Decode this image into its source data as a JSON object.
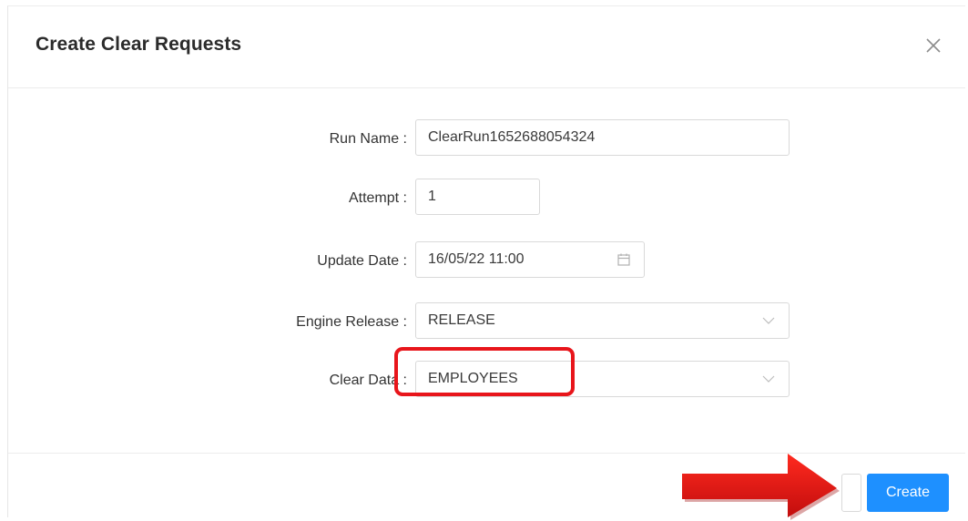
{
  "dialog": {
    "title": "Create Clear Requests"
  },
  "form": {
    "run_name": {
      "label": "Run Name :",
      "value": "ClearRun1652688054324"
    },
    "attempt": {
      "label": "Attempt :",
      "value": "1"
    },
    "update_date": {
      "label": "Update Date :",
      "value": "16/05/22 11:00",
      "icon": "calendar-icon"
    },
    "engine_release": {
      "label": "Engine Release :",
      "value": "RELEASE",
      "icon": "chevron-down-icon"
    },
    "clear_data": {
      "label": "Clear Data :",
      "value": "EMPLOYEES",
      "icon": "chevron-down-icon"
    }
  },
  "footer": {
    "create_label": "Create"
  },
  "colors": {
    "primary": "#1e90ff",
    "annotation": "#e8151b"
  }
}
